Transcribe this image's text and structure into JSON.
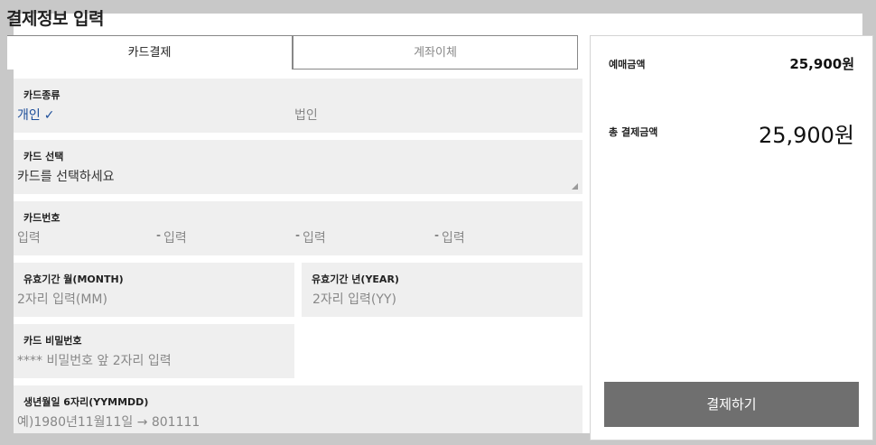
{
  "page": {
    "title": "결제정보 입력"
  },
  "tabs": [
    {
      "label": "카드결제",
      "active": true
    },
    {
      "label": "계좌이체",
      "active": false
    }
  ],
  "card_type": {
    "label": "카드종류",
    "options": [
      {
        "label": "개인",
        "selected": true,
        "check": "✓"
      },
      {
        "label": "법인",
        "selected": false
      }
    ]
  },
  "card_select": {
    "label": "카드 선택",
    "value": "카드를 선택하세요"
  },
  "card_number": {
    "label": "카드번호",
    "placeholders": [
      "입력",
      "입력",
      "입력",
      "입력"
    ],
    "separator": "-"
  },
  "expiry_month": {
    "label": "유효기간 월(MONTH)",
    "placeholder": "2자리 입력(MM)"
  },
  "expiry_year": {
    "label": "유효기간 년(YEAR)",
    "placeholder": "2자리 입력(YY)"
  },
  "card_password": {
    "label": "카드 비밀번호",
    "placeholder": "**** 비밀번호 앞 2자리 입력"
  },
  "birth_date": {
    "label": "생년월일 6자리(YYMMDD)",
    "placeholder": "예)1980년11월11일 → 801111"
  },
  "summary": {
    "ticket_amount_label": "예매금액",
    "ticket_amount_value": "25,900원",
    "total_label": "총 결제금액",
    "total_value": "25,900원"
  },
  "pay_button": {
    "label": "결제하기"
  },
  "colors": {
    "field_bg": "#efefef",
    "button_bg": "#6f6f6f",
    "selected_option": "#1d4e9a"
  }
}
